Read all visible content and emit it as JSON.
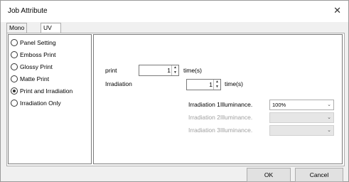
{
  "window": {
    "title": "Job Attribute",
    "close_icon": "close-icon"
  },
  "tabs": [
    {
      "label": "Mono Color"
    },
    {
      "label": "UV Mode"
    }
  ],
  "modes": [
    {
      "label": "Panel Setting",
      "selected": false
    },
    {
      "label": "Emboss Print",
      "selected": false
    },
    {
      "label": "Glossy Print",
      "selected": false
    },
    {
      "label": "Matte Print",
      "selected": false
    },
    {
      "label": "Print and Irradiation",
      "selected": true
    },
    {
      "label": "Irradiation Only",
      "selected": false
    }
  ],
  "settings": {
    "print": {
      "label": "print",
      "value": "1",
      "unit": "time(s)"
    },
    "irradiation": {
      "label": "Irradiation",
      "value": "1",
      "unit": "time(s)"
    },
    "illuminance": [
      {
        "label": "Irradiation 1Illuminance.",
        "value": "100%",
        "enabled": true
      },
      {
        "label": "Irradiation 2Illuminance.",
        "value": "",
        "enabled": false
      },
      {
        "label": "Irradiation 3Illuminance.",
        "value": "",
        "enabled": false
      }
    ]
  },
  "buttons": {
    "ok": "OK",
    "cancel": "Cancel"
  }
}
